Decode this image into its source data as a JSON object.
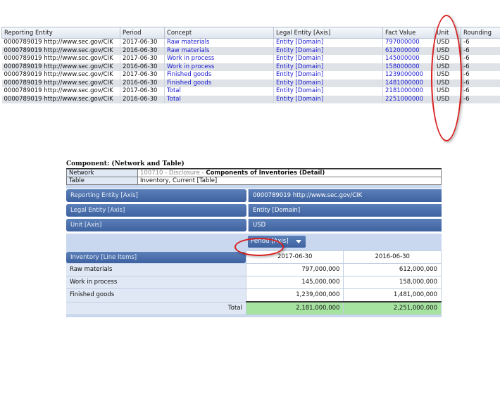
{
  "fact_table": {
    "headers": [
      "Reporting Entity",
      "Period",
      "Concept",
      "Legal Entity [Axis]",
      "Fact Value",
      "Unit",
      "Rounding"
    ],
    "rows": [
      [
        "0000789019 http://www.sec.gov/CIK",
        "2017-06-30",
        "Raw materials",
        "Entity [Domain]",
        "797000000",
        "USD",
        "-6"
      ],
      [
        "0000789019 http://www.sec.gov/CIK",
        "2016-06-30",
        "Raw materials",
        "Entity [Domain]",
        "612000000",
        "USD",
        "-6"
      ],
      [
        "0000789019 http://www.sec.gov/CIK",
        "2017-06-30",
        "Work in process",
        "Entity [Domain]",
        "145000000",
        "USD",
        "-6"
      ],
      [
        "0000789019 http://www.sec.gov/CIK",
        "2016-06-30",
        "Work in process",
        "Entity [Domain]",
        "158000000",
        "USD",
        "-6"
      ],
      [
        "0000789019 http://www.sec.gov/CIK",
        "2017-06-30",
        "Finished goods",
        "Entity [Domain]",
        "1239000000",
        "USD",
        "-6"
      ],
      [
        "0000789019 http://www.sec.gov/CIK",
        "2016-06-30",
        "Finished goods",
        "Entity [Domain]",
        "1481000000",
        "USD",
        "-6"
      ],
      [
        "0000789019 http://www.sec.gov/CIK",
        "2017-06-30",
        "Total",
        "Entity [Domain]",
        "2181000000",
        "USD",
        "-6"
      ],
      [
        "0000789019 http://www.sec.gov/CIK",
        "2016-06-30",
        "Total",
        "Entity [Domain]",
        "2251000000",
        "USD",
        "-6"
      ]
    ]
  },
  "component": {
    "title": "Component: (Network and Table)",
    "network_label": "Network",
    "network_id": "100710 - Disclosure - ",
    "network_name": "Components of Inventories (Detail)",
    "table_label": "Table",
    "table_name": "Inventory, Current [Table]",
    "axes": [
      {
        "label": "Reporting Entity [Axis]",
        "value": "0000789019 http://www.sec.gov/CIK"
      },
      {
        "label": "Legal Entity [Axis]",
        "value": "Entity [Domain]"
      },
      {
        "label": "Unit [Axis]",
        "value": "USD"
      }
    ],
    "period_button": "Period [Axis]",
    "line_items_label": "Inventory [Line Items]",
    "columns": [
      "2017-06-30",
      "2016-06-30"
    ],
    "rows": [
      {
        "label": "Raw materials",
        "values": [
          "797,000,000",
          "612,000,000"
        ]
      },
      {
        "label": "Work in process",
        "values": [
          "145,000,000",
          "158,000,000"
        ]
      },
      {
        "label": "Finished goods",
        "values": [
          "1,239,000,000",
          "1,481,000,000"
        ]
      }
    ],
    "total": {
      "label": "Total",
      "values": [
        "2,181,000,000",
        "2,251,000,000"
      ]
    }
  },
  "colors": {
    "highlight_oval": "#d82020",
    "axis_bar": "#3d62a0",
    "total_fill": "#a6e3a1",
    "link_blue": "#1a1ad0"
  }
}
